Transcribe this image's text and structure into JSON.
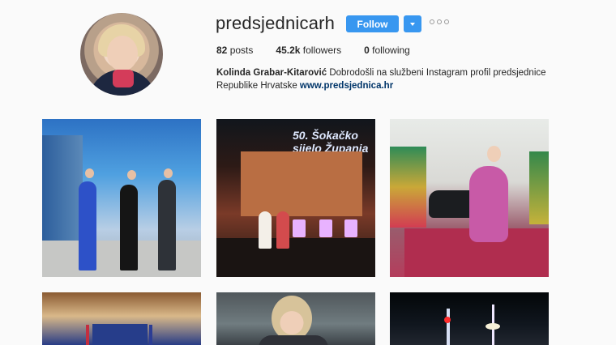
{
  "profile": {
    "username": "predsjednicarh",
    "follow_label": "Follow",
    "stats": [
      {
        "value": "82",
        "label": "posts"
      },
      {
        "value": "45.2k",
        "label": "followers"
      },
      {
        "value": "0",
        "label": "following"
      }
    ],
    "bio": {
      "name": "Kolinda Grabar-Kitarović",
      "text": "Dobrodošli na službeni Instagram profil predsjednice Republike Hrvatske",
      "link": "www.predsjednica.hr"
    }
  },
  "posts": {
    "post2_sign": "50. Šokačko sijelo Županja"
  },
  "icons": {
    "avatar": "profile-avatar",
    "dropdown": "chevron-down-icon",
    "more": "more-options-icon"
  },
  "colors": {
    "follow_button": "#3897f0",
    "link": "#003569"
  }
}
